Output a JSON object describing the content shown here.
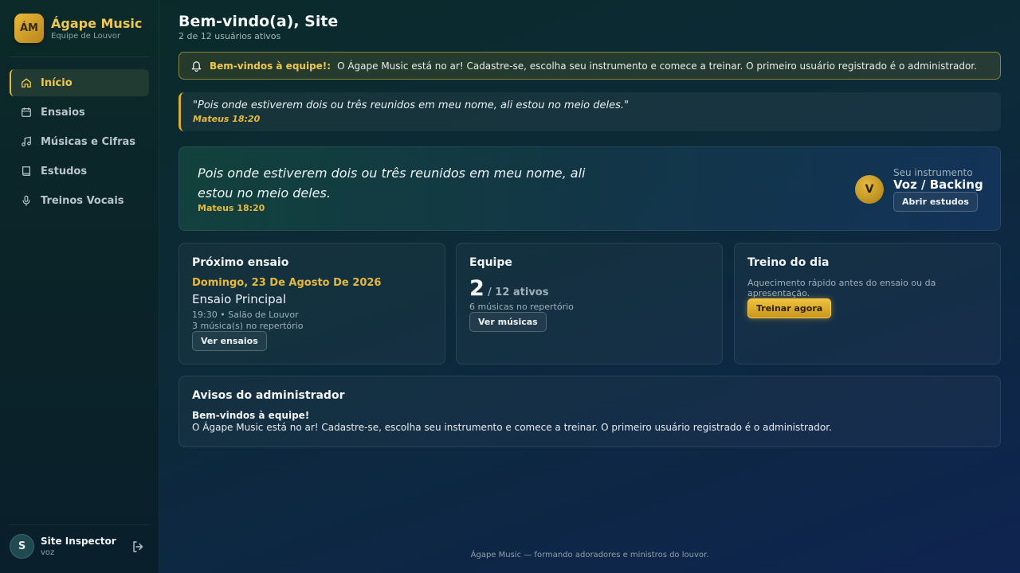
{
  "brand": {
    "logo": "ÁM",
    "name": "Ágape Music",
    "subtitle": "Equipe de Louvor"
  },
  "nav": [
    {
      "label": "Início",
      "icon": "home-icon",
      "active": true
    },
    {
      "label": "Ensaios",
      "icon": "calendar-icon",
      "active": false
    },
    {
      "label": "Músicas e Cifras",
      "icon": "music-note-icon",
      "active": false
    },
    {
      "label": "Estudos",
      "icon": "book-icon",
      "active": false
    },
    {
      "label": "Treinos Vocais",
      "icon": "microphone-icon",
      "active": false
    }
  ],
  "user": {
    "initial": "S",
    "name": "Site Inspector",
    "role": "voz"
  },
  "header": {
    "title": "Bem-vindo(a), Site",
    "subtitle": "2 de 12 usuários ativos"
  },
  "notice": {
    "title": "Bem-vindos à equipe!:",
    "text": "O Ágape Music está no ar! Cadastre-se, escolha seu instrumento e comece a treinar. O primeiro usuário registrado é o administrador."
  },
  "verse_strip": {
    "quote": "\"Pois onde estiverem dois ou três reunidos em meu nome, ali estou no meio deles.\"",
    "ref": "Mateus 18:20"
  },
  "hero": {
    "verse": "Pois onde estiverem dois ou três reunidos em meu nome, ali estou no meio deles.",
    "ref": "Mateus 18:20",
    "instrument_initial": "V",
    "instrument_label": "Seu instrumento",
    "instrument_value": "Voz / Backing",
    "button": "Abrir estudos"
  },
  "cards": {
    "rehearsal": {
      "title": "Próximo ensaio",
      "date": "Domingo, 23 De Agosto De 2026",
      "name": "Ensaio Principal",
      "time_place": "19:30 • Salão de Louvor",
      "songs": "3 música(s) no repertório",
      "button": "Ver ensaios"
    },
    "team": {
      "title": "Equipe",
      "count": "2",
      "suffix": "/ 12 ativos",
      "songs": "6 músicas no repertório",
      "button": "Ver músicas"
    },
    "training": {
      "title": "Treino do dia",
      "desc": "Aquecimento rápido antes do ensaio ou da apresentação.",
      "button": "Treinar agora"
    }
  },
  "admin": {
    "title": "Avisos do administrador",
    "item_title": "Bem-vindos à equipe!",
    "item_text": "O Ágape Music está no ar! Cadastre-se, escolha seu instrumento e comece a treinar. O primeiro usuário registrado é o administrador."
  },
  "footer": "Ágape Music — formando adoradores e ministros do louvor.",
  "colors": {
    "accent": "#e6b93c",
    "background": "#0c2a38"
  }
}
